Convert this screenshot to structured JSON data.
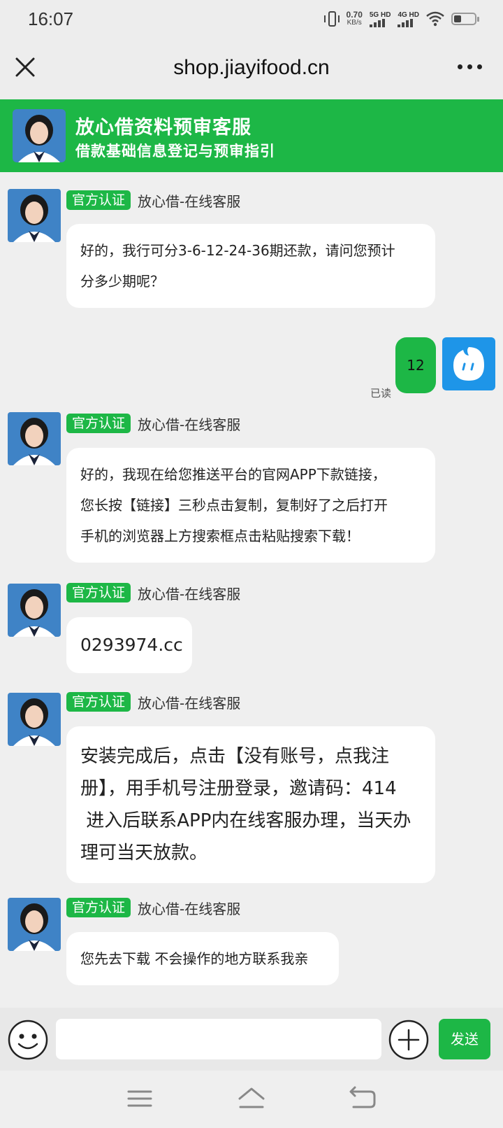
{
  "status": {
    "time": "16:07",
    "speed_value": "0.70",
    "speed_unit": "KB/s",
    "sim1": "5G HD",
    "sim2": "4G HD"
  },
  "titlebar": {
    "url": "shop.jiayifood.cn"
  },
  "banner": {
    "title": "放心借资料预审客服",
    "subtitle": "借款基础信息登记与预审指引"
  },
  "messages": [
    {
      "badge": "官方认证",
      "sender": "放心借-在线客服",
      "lines": [
        "好的，我行可分3-6-12-24-36期还款，请问您预计",
        "分多少期呢？"
      ]
    },
    {
      "badge": "官方认证",
      "sender": "放心借-在线客服",
      "lines": [
        "好的，我现在给您推送平台的官网APP下款链接，",
        "您长按【链接】三秒点击复制，复制好了之后打开",
        "手机的浏览器上方搜索框点击粘贴搜索下载！"
      ]
    },
    {
      "badge": "官方认证",
      "sender": "放心借-在线客服",
      "lines": [
        "0293974.cc"
      ]
    },
    {
      "badge": "官方认证",
      "sender": "放心借-在线客服",
      "lines": [
        "安装完成后，点击【没有账号，点我注",
        "册】，用手机号注册登录，邀请码：414",
        " 进入后联系APP内在线客服办理，当天办",
        "理可当天放款。"
      ]
    },
    {
      "badge": "官方认证",
      "sender": "放心借-在线客服",
      "lines": [
        "您先去下载 不会操作的地方联系我亲"
      ]
    }
  ],
  "my_message": {
    "text": "12",
    "read_status": "已读"
  },
  "inputbar": {
    "placeholder": "",
    "send_label": "发送"
  },
  "colors": {
    "accent": "#1db746",
    "my_avatar": "#1e95e8"
  }
}
